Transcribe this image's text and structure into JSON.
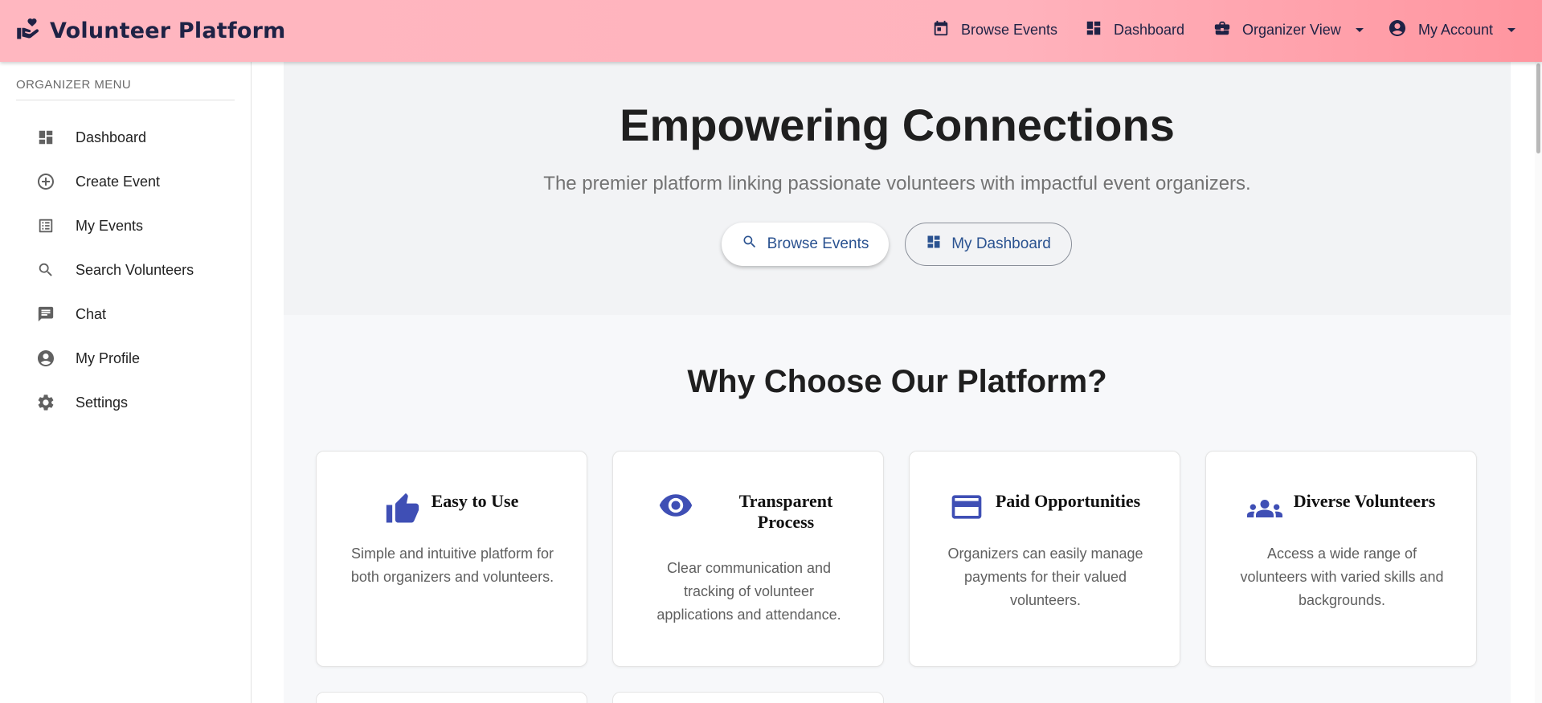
{
  "header": {
    "brand": "Volunteer Platform",
    "nav": {
      "browse_events": "Browse Events",
      "dashboard": "Dashboard",
      "organizer_view": "Organizer View",
      "my_account": "My Account"
    }
  },
  "sidebar": {
    "title": "ORGANIZER MENU",
    "items": [
      {
        "label": "Dashboard",
        "icon": "dashboard-icon"
      },
      {
        "label": "Create Event",
        "icon": "add-circle-icon"
      },
      {
        "label": "My Events",
        "icon": "list-icon"
      },
      {
        "label": "Search Volunteers",
        "icon": "search-icon"
      },
      {
        "label": "Chat",
        "icon": "chat-icon"
      },
      {
        "label": "My Profile",
        "icon": "account-circle-icon"
      },
      {
        "label": "Settings",
        "icon": "gear-icon"
      }
    ]
  },
  "hero": {
    "title": "Empowering Connections",
    "subtitle": "The premier platform linking passionate volunteers with impactful event organizers.",
    "primary_button": "Browse Events",
    "secondary_button": "My Dashboard"
  },
  "features": {
    "title": "Why Choose Our Platform?",
    "cards": [
      {
        "title": "Easy to Use",
        "description": "Simple and intuitive platform for both organizers and volunteers.",
        "icon": "thumb-up-icon"
      },
      {
        "title": "Transparent Process",
        "description": "Clear communication and tracking of volunteer applications and attendance.",
        "icon": "eye-icon"
      },
      {
        "title": "Paid Opportunities",
        "description": "Organizers can easily manage payments for their valued volunteers.",
        "icon": "credit-card-icon"
      },
      {
        "title": "Diverse Volunteers",
        "description": "Access a wide range of volunteers with varied skills and backgrounds.",
        "icon": "group-icon"
      }
    ]
  },
  "colors": {
    "header_gradient_start": "#ffb7c0",
    "header_gradient_end": "#ff959f",
    "brand_navy": "#1e2245",
    "feature_icon": "#3f4fb5",
    "button_text": "#2a5290"
  }
}
